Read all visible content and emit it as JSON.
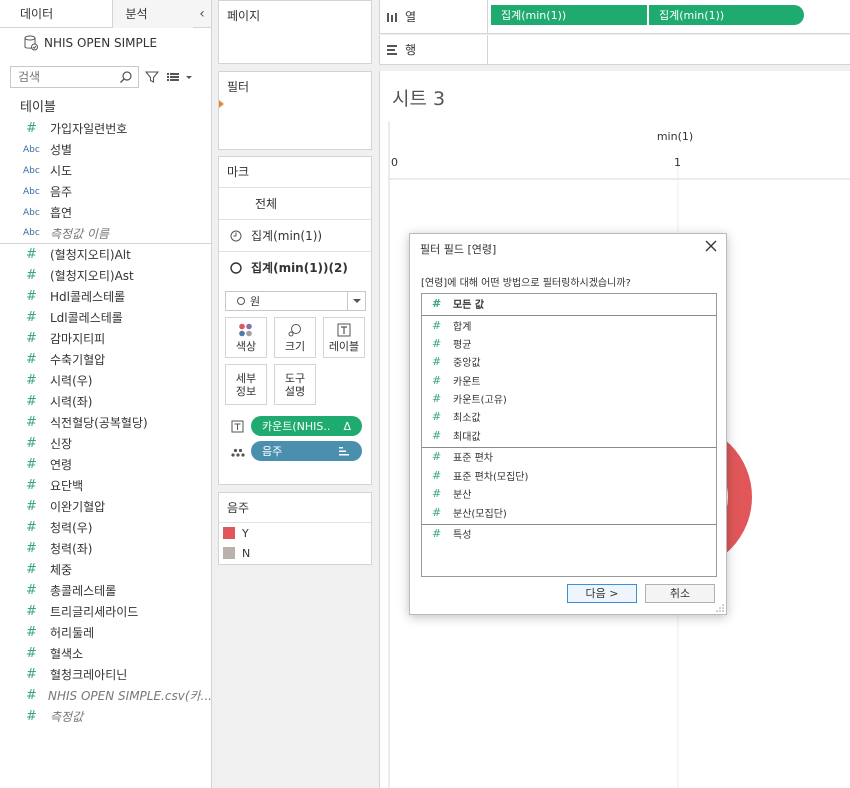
{
  "left_pane": {
    "tab_data": "데이터",
    "tab_analysis": "분석",
    "collapse": "‹",
    "datasource": "NHIS OPEN SIMPLE",
    "search_placeholder": "검색",
    "tables_heading": "테이블",
    "fields": [
      {
        "type": "#",
        "name": "가입자일련번호"
      },
      {
        "type": "Abc",
        "name": "성별"
      },
      {
        "type": "Abc",
        "name": "시도"
      },
      {
        "type": "Abc",
        "name": "음주"
      },
      {
        "type": "Abc",
        "name": "흡연"
      },
      {
        "type": "Abc",
        "name": "측정값 이름"
      },
      {
        "type": "#",
        "name": "(혈청지오티)Alt"
      },
      {
        "type": "#",
        "name": "(혈청지오티)Ast"
      },
      {
        "type": "#",
        "name": "Hdl콜레스테롤"
      },
      {
        "type": "#",
        "name": "Ldl콜레스테롤"
      },
      {
        "type": "#",
        "name": "감마지티피"
      },
      {
        "type": "#",
        "name": "수축기혈압"
      },
      {
        "type": "#",
        "name": "시력(우)"
      },
      {
        "type": "#",
        "name": "시력(좌)"
      },
      {
        "type": "#",
        "name": "식전혈당(공복혈당)"
      },
      {
        "type": "#",
        "name": "신장"
      },
      {
        "type": "#",
        "name": "연령"
      },
      {
        "type": "#",
        "name": "요단백"
      },
      {
        "type": "#",
        "name": "이완기혈압"
      },
      {
        "type": "#",
        "name": "청력(우)"
      },
      {
        "type": "#",
        "name": "청력(좌)"
      },
      {
        "type": "#",
        "name": "체중"
      },
      {
        "type": "#",
        "name": "총콜레스테롤"
      },
      {
        "type": "#",
        "name": "트리글리세라이드"
      },
      {
        "type": "#",
        "name": "허리둘레"
      },
      {
        "type": "#",
        "name": "혈색소"
      },
      {
        "type": "#",
        "name": "혈청크레아티닌"
      },
      {
        "type": "#",
        "name": "NHIS OPEN SIMPLE.csv(카..."
      },
      {
        "type": "#",
        "name": "측정값"
      }
    ]
  },
  "pages": {
    "title": "페이지"
  },
  "filters": {
    "title": "필터"
  },
  "marks": {
    "title": "마크",
    "all": "전체",
    "row1": "집계(min(1))",
    "row2": "집계(min(1))(2)",
    "mark_type": "원",
    "buttons": {
      "color": "색상",
      "size": "크기",
      "label": "레이블",
      "detail": "세부\n정보",
      "tooltip": "도구\n설명"
    },
    "pill_count": "카운트(NHIS..",
    "pill_count_delta": "Δ",
    "pill_drink": "음주"
  },
  "legend": {
    "title": "음주",
    "items": [
      {
        "label": "Y",
        "color": "#e15759"
      },
      {
        "label": "N",
        "color": "#bab0ac"
      }
    ]
  },
  "columns_shelf": {
    "label": "열",
    "pills": [
      "집계(min(1))",
      "집계(min(1))"
    ]
  },
  "rows_shelf": {
    "label": "행"
  },
  "viz": {
    "sheet_title": "시트 3",
    "axis_title": "min(1)",
    "axis_ticks": [
      "0",
      "1"
    ]
  },
  "dialog": {
    "title": "필터 필드 [연령]",
    "question": "[연령]에 대해 어떤 방법으로 필터링하시겠습니까?",
    "options": [
      {
        "label": "모든 값",
        "selected": true,
        "sep": true
      },
      {
        "label": "합계"
      },
      {
        "label": "평균"
      },
      {
        "label": "중앙값"
      },
      {
        "label": "카운트"
      },
      {
        "label": "카운트(고유)"
      },
      {
        "label": "최소값"
      },
      {
        "label": "최대값",
        "sep": true
      },
      {
        "label": "표준 편차"
      },
      {
        "label": "표준 편차(모집단)"
      },
      {
        "label": "분산"
      },
      {
        "label": "분산(모집단)",
        "sep": true
      },
      {
        "label": "특성"
      }
    ],
    "next_button": "다음 >",
    "cancel_button": "취소"
  },
  "colors": {
    "pill_green": "#1fab6f",
    "pill_blue": "#4a8fae",
    "donut_red": "#e15759"
  }
}
